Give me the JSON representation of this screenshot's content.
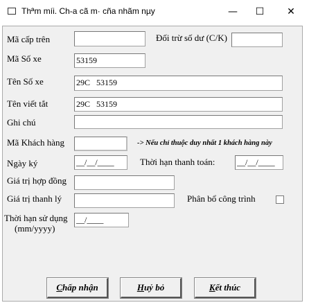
{
  "window": {
    "title": "Thªm míi. Ch-a cã m· cña nhãm nµy",
    "minimize": "—",
    "maximize": "☐",
    "close": "✕"
  },
  "fields": {
    "ma_cap_tren": {
      "label": "Mã cấp trên",
      "value": ""
    },
    "doi_tru": {
      "label": "Đối trừ số dư (C/K)",
      "value": ""
    },
    "ma_so_xe": {
      "label": "Mã Số xe",
      "value": "53159"
    },
    "ten_so_xe": {
      "label": "Tên Số xe",
      "value": "29C   53159"
    },
    "ten_viet_tat": {
      "label": "Tên viết tắt",
      "value": "29C   53159"
    },
    "ghi_chu": {
      "label": "Ghi chú",
      "value": ""
    },
    "ma_khach_hang": {
      "label": "Mã Khách hàng",
      "value": "",
      "note": "-> Nếu chỉ thuộc duy nhất 1 khách hàng này"
    },
    "ngay_ky": {
      "label": "Ngày ký",
      "value": "__/__/____"
    },
    "thoi_han_thanh_toan": {
      "label": "Thời hạn thanh toán:",
      "value": "__/__/____"
    },
    "gia_tri_hop_dong": {
      "label": "Giá trị hợp đồng",
      "value": ""
    },
    "gia_tri_thanh_ly": {
      "label": "Giá trị thanh lý",
      "value": ""
    },
    "phan_bo": {
      "label": "Phân bổ công trình",
      "checked": false
    },
    "thoi_han_su_dung": {
      "label": "Thời hạn sử dụng",
      "label2": "(mm/yyyy)",
      "value": "__/____"
    }
  },
  "buttons": {
    "accept": {
      "key": "C",
      "rest": "hấp nhận"
    },
    "cancel": {
      "key": "H",
      "rest": "uỷ bỏ"
    },
    "finish": {
      "key": "K",
      "rest": "ết thúc"
    }
  }
}
